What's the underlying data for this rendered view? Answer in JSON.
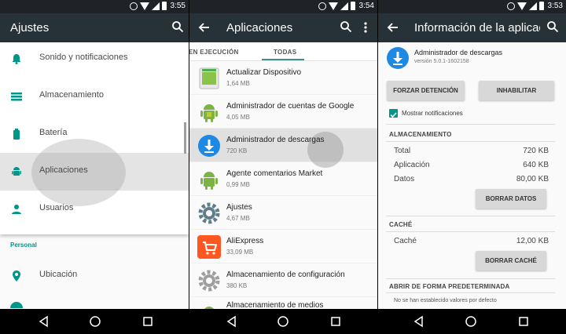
{
  "status": {
    "time1": "3:55",
    "time2": "3:54",
    "time3": "3:53"
  },
  "panel1": {
    "title": "Ajustes",
    "items": [
      {
        "label": "Sonido y notificaciones",
        "icon": "bell-icon"
      },
      {
        "label": "Almacenamiento",
        "icon": "storage-icon"
      },
      {
        "label": "Batería",
        "icon": "battery-icon"
      },
      {
        "label": "Aplicaciones",
        "icon": "android-icon"
      },
      {
        "label": "Usuarios",
        "icon": "person-icon"
      }
    ],
    "section_personal": "Personal",
    "item_location": {
      "label": "Ubicación",
      "icon": "location-icon"
    }
  },
  "panel2": {
    "title": "Aplicaciones",
    "tab_running": "EN EJECUCIÓN",
    "tab_all": "TODAS",
    "apps": [
      {
        "name": "Actualizar Dispositivo",
        "size": "1,64 MB"
      },
      {
        "name": "Administrador de cuentas de Google",
        "size": "4,05 MB"
      },
      {
        "name": "Administrador de descargas",
        "size": "720 KB"
      },
      {
        "name": "Agente comentarios Market",
        "size": "0,99 MB"
      },
      {
        "name": "Ajustes",
        "size": "4,67 MB"
      },
      {
        "name": "AliExpress",
        "size": "33,09 MB"
      },
      {
        "name": "Almacenamiento de configuración",
        "size": "380 KB"
      },
      {
        "name": "Almacenamiento de medios",
        "size": ""
      }
    ]
  },
  "panel3": {
    "title": "Información de la aplicac",
    "app_name": "Administrador de descargas",
    "app_version": "versión 5.0.1-1602158",
    "force_stop": "FORZAR DETENCIÓN",
    "disable": "INHABILITAR",
    "show_notifications": "Mostrar notificaciones",
    "storage_header": "ALMACENAMIENTO",
    "total_label": "Total",
    "total_value": "720 KB",
    "app_label": "Aplicación",
    "app_value": "640 KB",
    "data_label": "Datos",
    "data_value": "80,00 KB",
    "clear_data": "BORRAR DATOS",
    "cache_header": "CACHÉ",
    "cache_label": "Caché",
    "cache_value": "12,00 KB",
    "clear_cache": "BORRAR CACHÉ",
    "default_header": "ABRIR DE FORMA PREDETERMINADA",
    "default_text": "No se han establecido valores por defecto"
  },
  "colors": {
    "accent": "#009688",
    "appbar": "#263238",
    "statusbar": "#1f2328",
    "download_blue": "#1e88e5"
  }
}
